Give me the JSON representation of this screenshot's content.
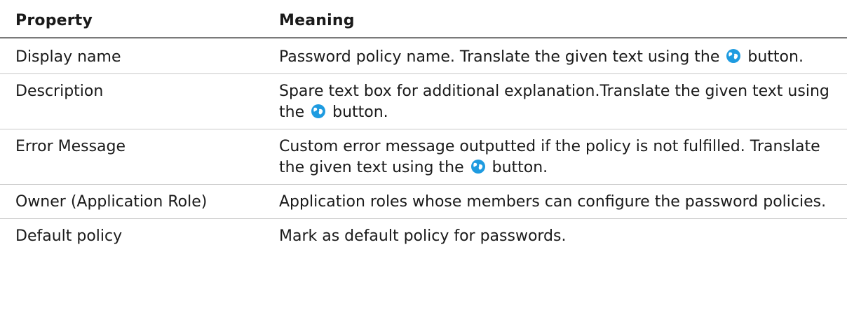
{
  "table": {
    "headers": [
      "Property",
      "Meaning"
    ],
    "rows": [
      {
        "property": "Display name",
        "meaning_before": "Password policy name. Translate the given text using the",
        "icon": "translate-globe-icon",
        "meaning_after": "button."
      },
      {
        "property": "Description",
        "meaning_before": "Spare text box for additional explanation.Translate the given text using the",
        "icon": "translate-globe-icon",
        "meaning_after": "button."
      },
      {
        "property": "Error Message",
        "meaning_before": "Custom error message outputted if the policy is not fulfilled. Translate the given text using the",
        "icon": "translate-globe-icon",
        "meaning_after": "button."
      },
      {
        "property": "Owner (Application Role)",
        "meaning_before": "Application roles whose members can configure the password policies.",
        "icon": null,
        "meaning_after": ""
      },
      {
        "property": "Default policy",
        "meaning_before": "Mark as default policy for passwords.",
        "icon": null,
        "meaning_after": ""
      }
    ]
  },
  "colors": {
    "icon_blue": "#1e9be0",
    "header_rule": "#7a7a7a",
    "row_rule": "#c8c8c8"
  }
}
